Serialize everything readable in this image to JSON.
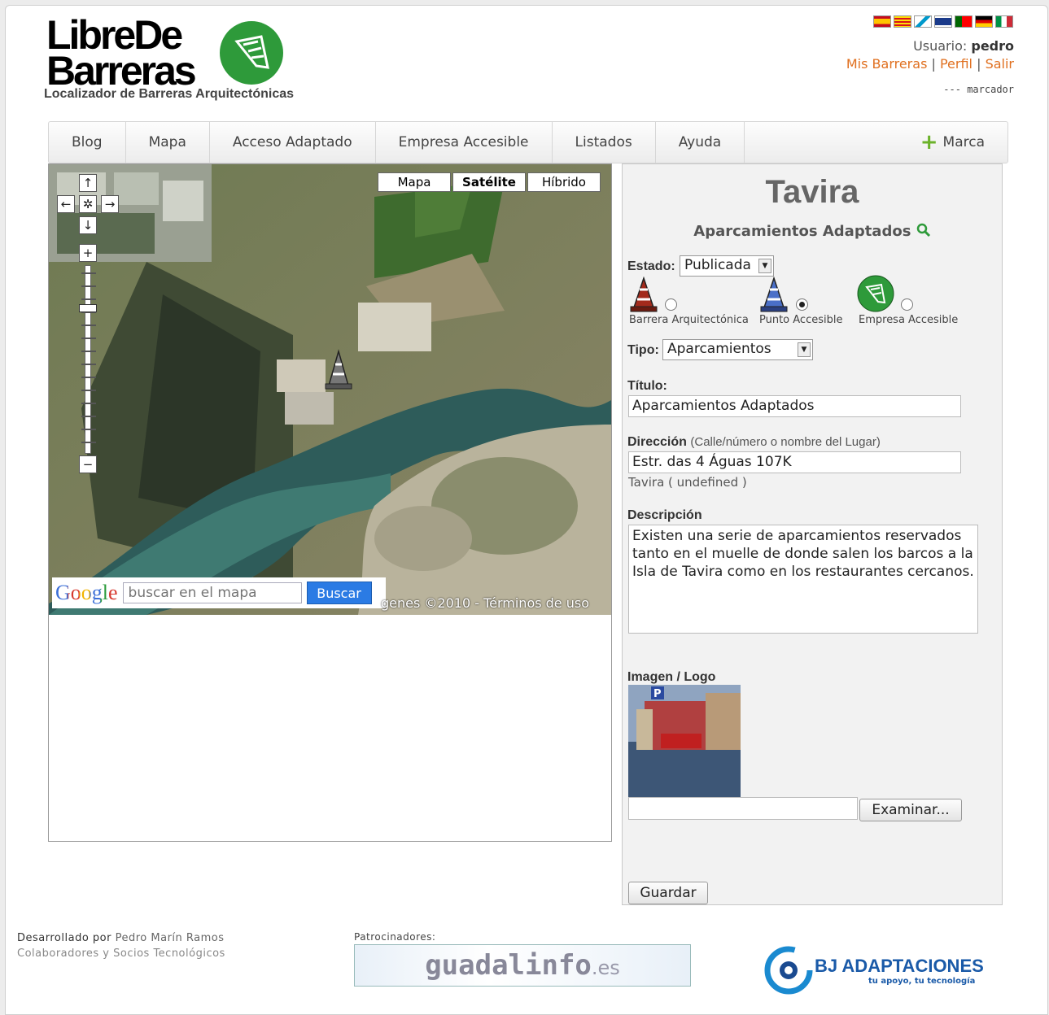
{
  "header": {
    "logo_line1": "LibreDe",
    "logo_line2": "Barreras",
    "tagline": "Localizador de Barreras Arquitectónicas",
    "flags": [
      "es-flag",
      "ca-flag",
      "gl-flag",
      "en-flag",
      "pt-flag",
      "de-flag",
      "it-flag"
    ],
    "user_label": "Usuario:",
    "user_name": "pedro",
    "links": [
      "Mis Barreras",
      "Perfil",
      "Salir"
    ],
    "marker_text": "--- marcador"
  },
  "nav": {
    "items": [
      "Blog",
      "Mapa",
      "Acceso Adaptado",
      "Empresa Accesible",
      "Listados",
      "Ayuda"
    ],
    "mark_label": "Marca"
  },
  "map": {
    "types": [
      "Mapa",
      "Satélite",
      "Híbrido"
    ],
    "selected_type": "Satélite",
    "search_logo": "Google",
    "search_placeholder": "buscar en el mapa",
    "search_button": "Buscar",
    "copyright": "genes ©2010 - Términos de uso"
  },
  "panel": {
    "title": "Tavira",
    "subtitle": "Aparcamientos Adaptados",
    "estado_label": "Estado:",
    "estado_value": "Publicada",
    "options": [
      {
        "label": "Barrera Arquitectónica",
        "checked": false
      },
      {
        "label": "Punto Accesible",
        "checked": true
      },
      {
        "label": "Empresa Accesible",
        "checked": false
      }
    ],
    "tipo_label": "Tipo:",
    "tipo_value": "Aparcamientos",
    "titulo_label": "Título:",
    "titulo_value": "Aparcamientos Adaptados",
    "direccion_label": "Dirección",
    "direccion_hint": "(Calle/número o nombre del Lugar)",
    "direccion_value": "Estr. das 4 Águas 107K",
    "direccion_city": "Tavira ( undefined )",
    "descripcion_label": "Descripción",
    "descripcion_value": "Existen una serie de aparcamientos reservados tanto en el muelle de donde salen los barcos a la Isla de Tavira como en los restaurantes cercanos.",
    "imagen_label": "Imagen / Logo",
    "browse_button": "Examinar...",
    "save_button": "Guardar"
  },
  "footer": {
    "dev_prefix": "Desarrollado por",
    "dev_name": "Pedro Marín Ramos",
    "collab": "Colaboradores y Socios Tecnológicos",
    "sponsors_label": "Patrocinadores:",
    "sponsor1_main": "guadalinfo",
    "sponsor1_tld": ".es",
    "sponsor2_name": "BJ ADAPTACIONES",
    "sponsor2_slogan": "tu apoyo, tu tecnología"
  },
  "colors": {
    "link": "#e07020",
    "accent_green": "#2e9a3a",
    "search_button": "#2b7be4"
  }
}
